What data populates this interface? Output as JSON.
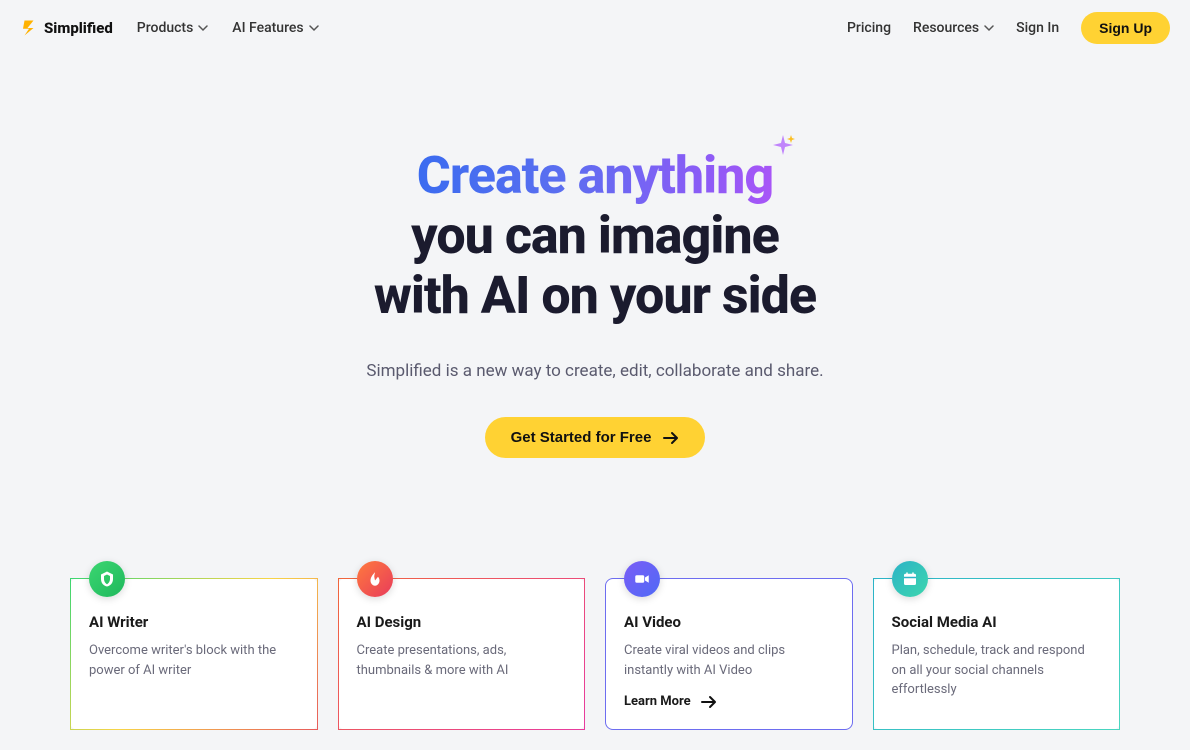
{
  "brand": "Simplified",
  "nav": {
    "items": [
      {
        "label": "Products"
      },
      {
        "label": "AI Features"
      }
    ],
    "right": {
      "pricing": "Pricing",
      "resources": "Resources",
      "signin": "Sign In",
      "signup": "Sign Up"
    }
  },
  "hero": {
    "gradient_text": "Create anything",
    "line2": "you can imagine",
    "line3": "with AI on your side",
    "subtitle": "Simplified is a new way to create, edit, collaborate and share.",
    "cta": "Get Started for Free"
  },
  "cards": [
    {
      "title": "AI Writer",
      "desc": "Overcome writer's block with the power of AI writer"
    },
    {
      "title": "AI Design",
      "desc": "Create presentations, ads, thumbnails & more with AI"
    },
    {
      "title": "AI Video",
      "desc": "Create viral videos and clips instantly with AI Video",
      "link": "Learn More"
    },
    {
      "title": "Social Media AI",
      "desc": "Plan, schedule, track and respond on all your social channels effortlessly"
    }
  ]
}
